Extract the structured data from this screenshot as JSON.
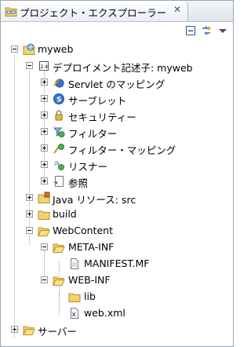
{
  "view": {
    "title": "プロジェクト・エクスプローラー",
    "close_glyph": "✕"
  },
  "toolbar": {
    "collapse_icon": "collapse-all-icon",
    "link_icon": "link-with-editor-icon",
    "menu_icon": "view-menu-icon"
  },
  "tree": {
    "project": "myweb",
    "deployment_descriptor": "デプロイメント記述子: myweb",
    "dd_children": [
      "Servlet のマッピング",
      "サーブレット",
      "セキュリティー",
      "フィルター",
      "フィルター・マッピング",
      "リスナー",
      "参照"
    ],
    "java_resources": "Java リソース: src",
    "build": "build",
    "webcontent": "WebContent",
    "meta_inf": "META-INF",
    "manifest": "MANIFEST.MF",
    "web_inf": "WEB-INF",
    "lib": "lib",
    "web_xml": "web.xml",
    "servers": "サーバー"
  },
  "colors": {
    "folder": "#f2d36b",
    "folder_border": "#b8902a",
    "accent_blue": "#2b6cc4",
    "tree_line": "#a0a0a0"
  }
}
